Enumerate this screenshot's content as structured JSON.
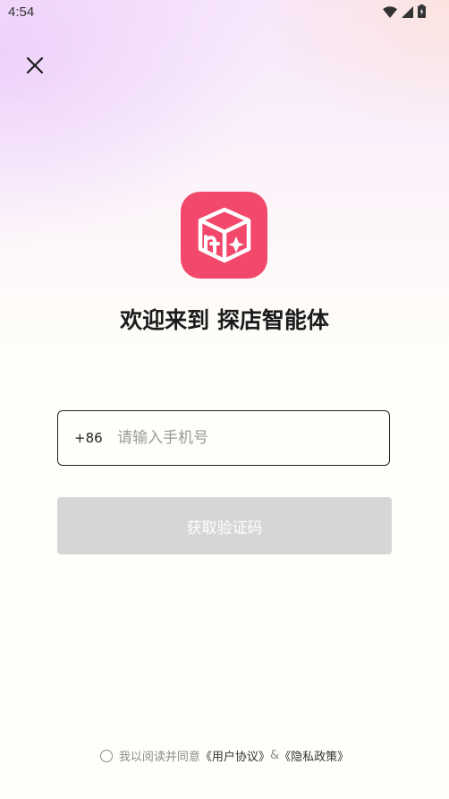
{
  "status_bar": {
    "time": "4:54",
    "icons": [
      "wifi-icon",
      "signal-icon",
      "battery-icon"
    ]
  },
  "close_icon": "close-icon",
  "logo": {
    "icon": "app-logo-cube-icon",
    "color": "#f2486c"
  },
  "welcome": {
    "title": "欢迎来到 探店智能体"
  },
  "phone": {
    "country_code": "+86",
    "placeholder": "请输入手机号",
    "value": ""
  },
  "code_button": {
    "label": "获取验证码",
    "color": "#d6d6d6"
  },
  "agreement": {
    "prefix": "我以阅读并同意",
    "user_agreement": "《用户协议》",
    "separator": "&",
    "privacy_policy": "《隐私政策》"
  }
}
